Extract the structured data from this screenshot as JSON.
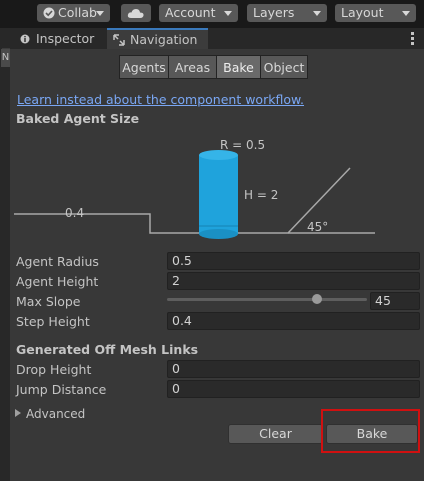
{
  "toolbar": {
    "collab_label": "Collab",
    "account_label": "Account",
    "layers_label": "Layers",
    "layout_label": "Layout",
    "icons": [
      "check-circle-icon",
      "cloud-icon"
    ]
  },
  "tabs": {
    "inspector": "Inspector",
    "navigation": "Navigation",
    "left_edge_letter": "N"
  },
  "nav_tabs": [
    "Agents",
    "Areas",
    "Bake",
    "Object"
  ],
  "selected_nav_tab": "Bake",
  "link_text": "Learn instead about the component workflow.",
  "baked_agent_size": {
    "header": "Baked Agent Size",
    "radius_label": "R = 0.5",
    "height_label": "H = 2",
    "step_label": "0.4",
    "slope_label": "45°"
  },
  "fields": {
    "agent_radius": {
      "label": "Agent Radius",
      "value": "0.5"
    },
    "agent_height": {
      "label": "Agent Height",
      "value": "2"
    },
    "max_slope": {
      "label": "Max Slope",
      "value": "45",
      "slider_fraction": 0.75
    },
    "step_height": {
      "label": "Step Height",
      "value": "0.4"
    }
  },
  "off_mesh": {
    "header": "Generated Off Mesh Links",
    "drop_height": {
      "label": "Drop Height",
      "value": "0"
    },
    "jump_distance": {
      "label": "Jump Distance",
      "value": "0"
    }
  },
  "advanced_label": "Advanced",
  "buttons": {
    "clear": "Clear",
    "bake": "Bake"
  },
  "colors": {
    "accent_cylinder": "#1fa3dc",
    "highlight_box": "#d01010",
    "link": "#7aa7f4"
  }
}
